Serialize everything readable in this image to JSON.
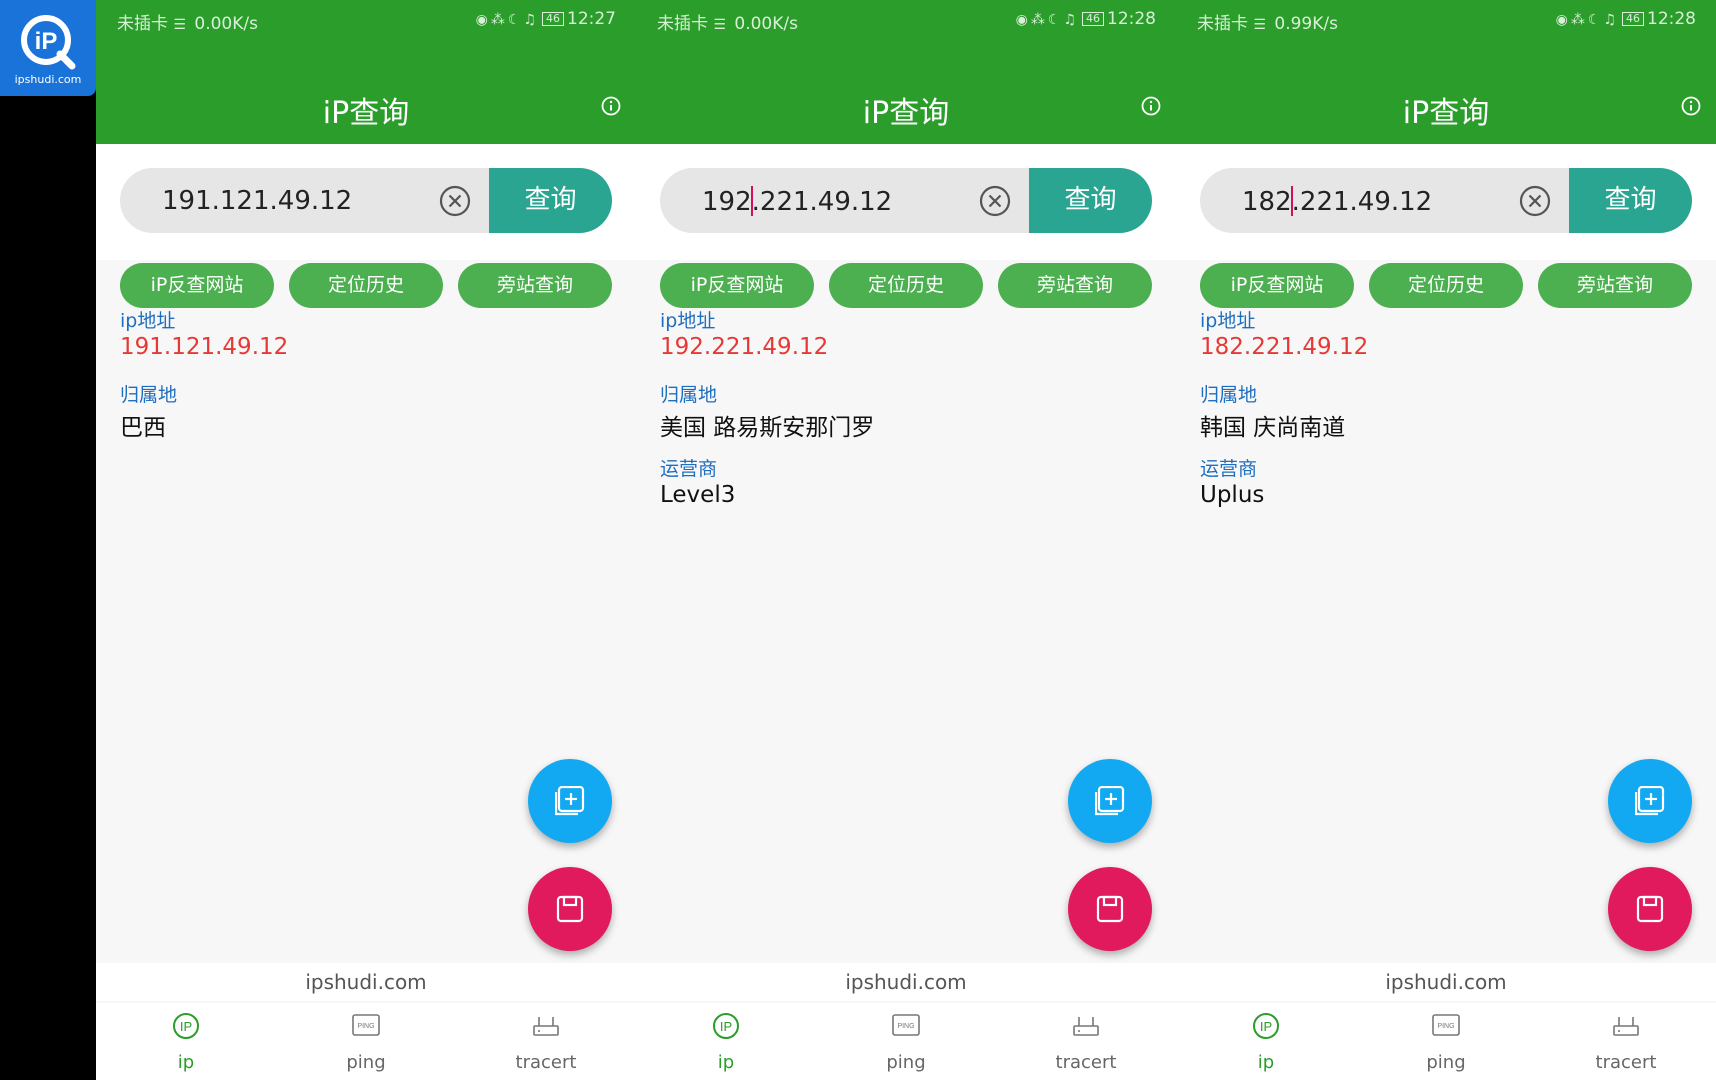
{
  "logo": {
    "domain": "ipshudi.com",
    "mark": "iP"
  },
  "panels": [
    {
      "status": {
        "carrier": "未插卡",
        "speed": "0.00K/s",
        "battery": "46",
        "time": "12:27"
      },
      "title": "iP查询",
      "search": {
        "before_caret": "191.121.49.12",
        "after_caret": "",
        "show_caret": false,
        "button": "查询"
      },
      "chips": [
        "iP反查网站",
        "定位历史",
        "旁站查询"
      ],
      "fields": [
        {
          "label": "ip地址",
          "value": "191.121.49.12",
          "highlight": true
        },
        {
          "label": "归属地",
          "value": "巴西",
          "highlight": false
        }
      ],
      "footer": "ipshudi.com",
      "nav": [
        {
          "label": "ip",
          "icon": "ip-icon"
        },
        {
          "label": "ping",
          "icon": "ping-icon"
        },
        {
          "label": "tracert",
          "icon": "router-icon"
        }
      ],
      "active_tab": 0
    },
    {
      "status": {
        "carrier": "未插卡",
        "speed": "0.00K/s",
        "battery": "46",
        "time": "12:28"
      },
      "title": "iP查询",
      "search": {
        "before_caret": "192",
        "after_caret": ".221.49.12",
        "show_caret": true,
        "button": "查询"
      },
      "chips": [
        "iP反查网站",
        "定位历史",
        "旁站查询"
      ],
      "fields": [
        {
          "label": "ip地址",
          "value": "192.221.49.12",
          "highlight": true
        },
        {
          "label": "归属地",
          "value": "美国 路易斯安那门罗",
          "highlight": false
        },
        {
          "label": "运营商",
          "value": "Level3",
          "highlight": false
        }
      ],
      "footer": "ipshudi.com",
      "nav": [
        {
          "label": "ip",
          "icon": "ip-icon"
        },
        {
          "label": "ping",
          "icon": "ping-icon"
        },
        {
          "label": "tracert",
          "icon": "router-icon"
        }
      ],
      "active_tab": 0
    },
    {
      "status": {
        "carrier": "未插卡",
        "speed": "0.99K/s",
        "battery": "46",
        "time": "12:28"
      },
      "title": "iP查询",
      "search": {
        "before_caret": "182",
        "after_caret": ".221.49.12",
        "show_caret": true,
        "button": "查询"
      },
      "chips": [
        "iP反查网站",
        "定位历史",
        "旁站查询"
      ],
      "fields": [
        {
          "label": "ip地址",
          "value": "182.221.49.12",
          "highlight": true
        },
        {
          "label": "归属地",
          "value": "韩国 庆尚南道",
          "highlight": false
        },
        {
          "label": "运营商",
          "value": "Uplus",
          "highlight": false
        }
      ],
      "footer": "ipshudi.com",
      "nav": [
        {
          "label": "ip",
          "icon": "ip-icon"
        },
        {
          "label": "ping",
          "icon": "ping-icon"
        },
        {
          "label": "tracert",
          "icon": "router-icon"
        }
      ],
      "active_tab": 0
    }
  ],
  "colors": {
    "appbar": "#2a9d2a",
    "query_button": "#2aa592",
    "chip": "#4caf50",
    "label": "#1e6ebf",
    "ip_value": "#e53935",
    "fab_add": "#13a9f2",
    "fab_save": "#e01a5c"
  }
}
